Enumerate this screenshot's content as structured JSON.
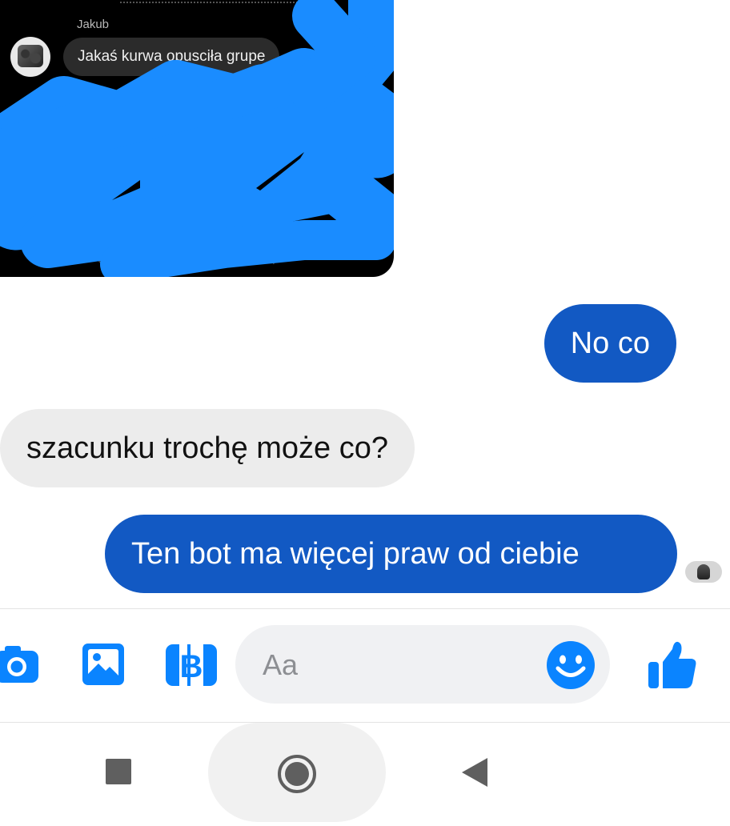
{
  "shared_image": {
    "sender_name": "Jakub",
    "message": "Jakaś kurwa opusciła grupe"
  },
  "messages": [
    {
      "direction": "outgoing",
      "text": "No co"
    },
    {
      "direction": "incoming",
      "text": "szacunku trochę może co?"
    },
    {
      "direction": "outgoing",
      "text": "Ten bot ma więcej praw od ciebie"
    }
  ],
  "composer": {
    "placeholder": "Aa",
    "icons": [
      "camera-icon",
      "gallery-icon",
      "voice-clip-icon",
      "emoji-icon",
      "like-icon"
    ]
  },
  "system_nav": {
    "icons": [
      "recents-icon",
      "home-icon",
      "back-icon"
    ]
  },
  "colors": {
    "accent": "#0a84ff",
    "outgoing_bubble": "#1259c3",
    "incoming_bubble": "#ececec",
    "scribble": "#1a8cff",
    "composer_bg": "#f0f1f3"
  }
}
